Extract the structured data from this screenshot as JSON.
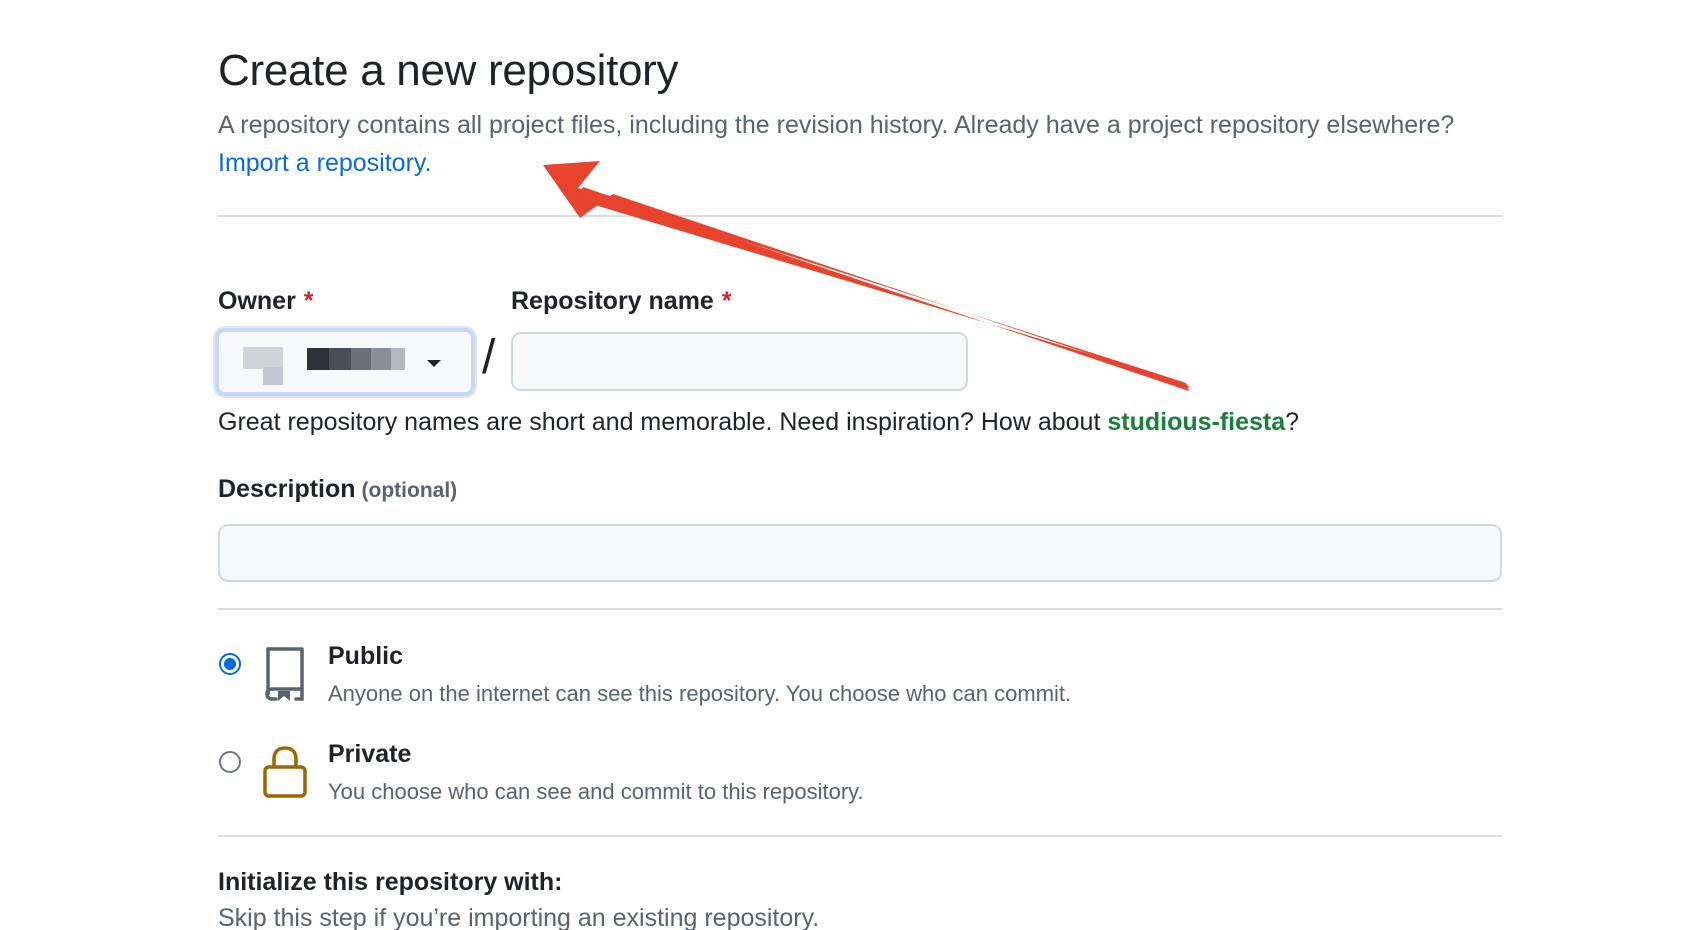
{
  "header": {
    "title": "Create a new repository",
    "subtitle_text": "A repository contains all project files, including the revision history. Already have a project repository elsewhere?",
    "import_link": "Import a repository."
  },
  "form": {
    "owner": {
      "label": "Owner",
      "required_mark": "*"
    },
    "separator": "/",
    "repo_name": {
      "label": "Repository name",
      "required_mark": "*",
      "value": ""
    },
    "name_hint": {
      "text": "Great repository names are short and memorable. Need inspiration? How about",
      "suggestion": "studious-fiesta",
      "suffix": "?"
    },
    "description": {
      "label": "Description",
      "optional": "(optional)",
      "value": ""
    }
  },
  "visibility": {
    "options": [
      {
        "title": "Public",
        "description": "Anyone on the internet can see this repository. You choose who can commit.",
        "selected": true,
        "icon": "repo-icon"
      },
      {
        "title": "Private",
        "description": "You choose who can see and commit to this repository.",
        "selected": false,
        "icon": "lock-icon"
      }
    ]
  },
  "initialize": {
    "title": "Initialize this repository with:",
    "subtitle": "Skip this step if you’re importing an existing repository."
  },
  "colors": {
    "link": "#0969da",
    "suggestion": "#1a7f37",
    "required": "#d1242f",
    "annotation_arrow": "#e8432d",
    "lock_icon": "#9a6700"
  }
}
